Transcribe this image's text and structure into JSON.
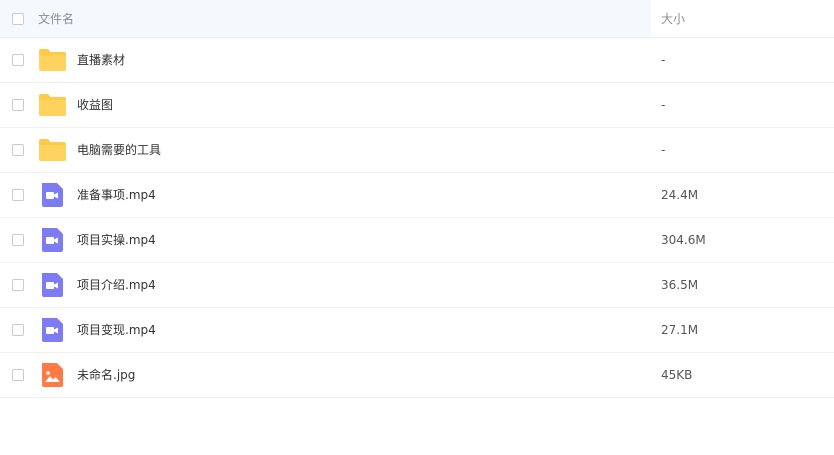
{
  "header": {
    "name_label": "文件名",
    "size_label": "大小"
  },
  "files": [
    {
      "name": "直播素材",
      "size": "-",
      "type": "folder"
    },
    {
      "name": "收益图",
      "size": "-",
      "type": "folder"
    },
    {
      "name": "电脑需要的工具",
      "size": "-",
      "type": "folder"
    },
    {
      "name": "准备事项.mp4",
      "size": "24.4M",
      "type": "video"
    },
    {
      "name": "项目实操.mp4",
      "size": "304.6M",
      "type": "video"
    },
    {
      "name": "项目介绍.mp4",
      "size": "36.5M",
      "type": "video"
    },
    {
      "name": "项目变现.mp4",
      "size": "27.1M",
      "type": "video"
    },
    {
      "name": "未命名.jpg",
      "size": "45KB",
      "type": "image"
    }
  ],
  "colors": {
    "folder": "#ffc94a",
    "video": "#7e7cf2",
    "image": "#ff7a45",
    "header_bg": "#f5f8fd"
  },
  "icons": {
    "folder": "folder-icon",
    "video": "video-file-icon",
    "image": "image-file-icon"
  }
}
